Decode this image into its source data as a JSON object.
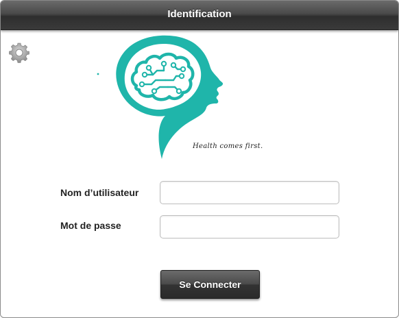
{
  "window": {
    "title": "Identification"
  },
  "settings": {
    "icon": "gear-icon"
  },
  "logo": {
    "tagline": "Health comes first.",
    "color": "#1fb5aa"
  },
  "form": {
    "username_label": "Nom d’utilisateur",
    "username_value": "",
    "password_label": "Mot de passe",
    "password_value": "",
    "submit_label": "Se Connecter"
  }
}
